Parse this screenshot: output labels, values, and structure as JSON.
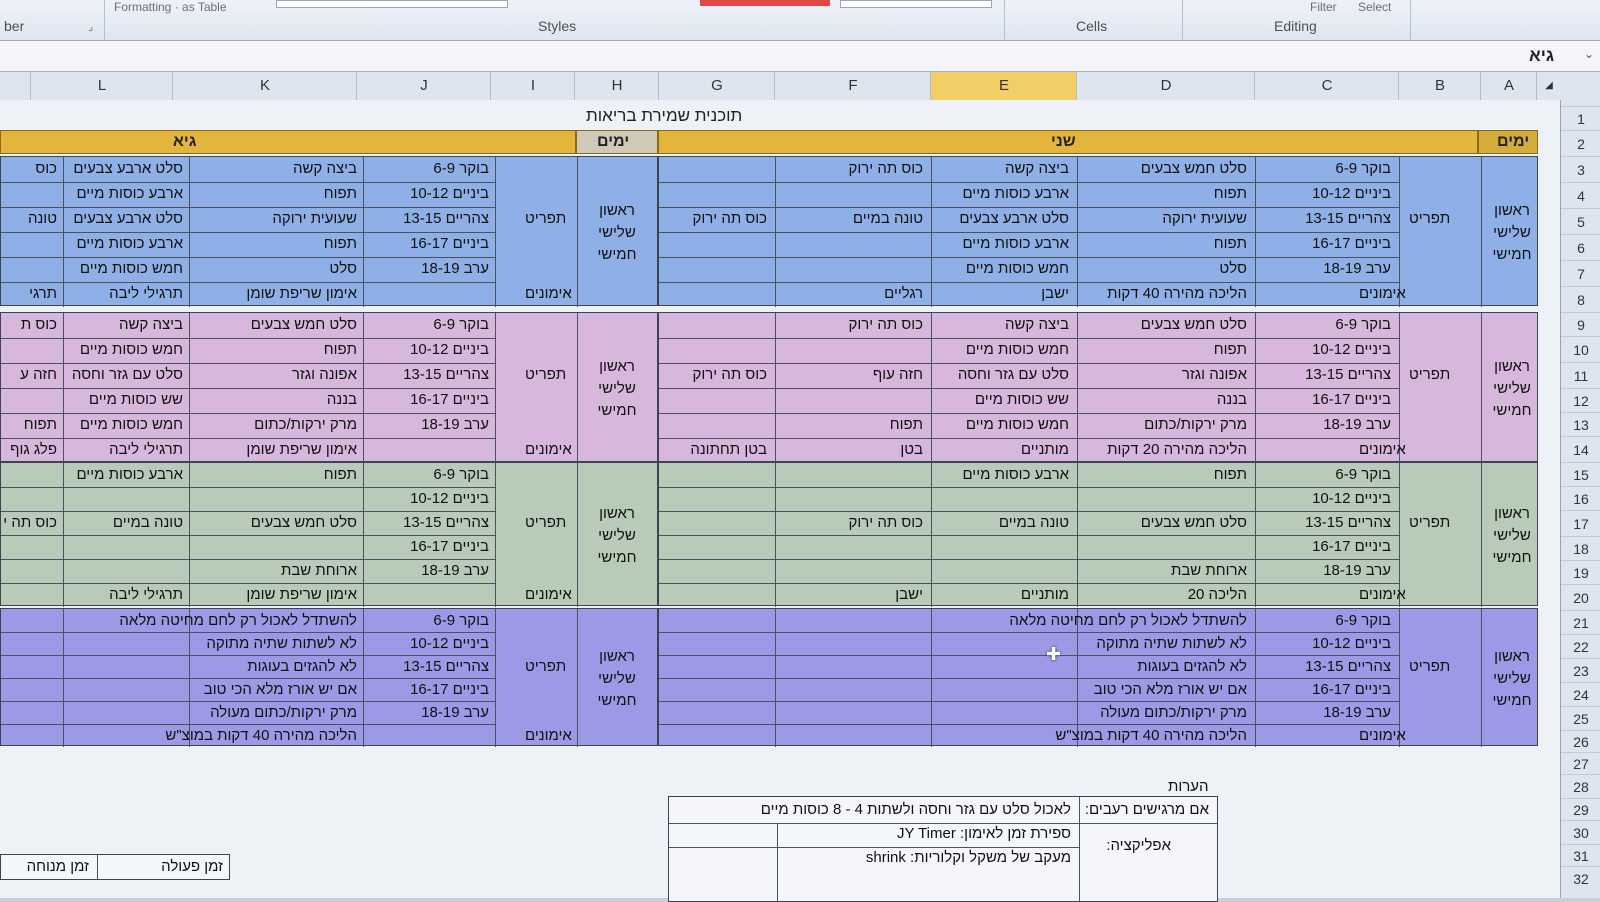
{
  "ribbon": {
    "groups": [
      "ber",
      "Styles",
      "Cells",
      "Editing"
    ],
    "faint": [
      "Formatting",
      "as Table",
      "Filter",
      "Select"
    ]
  },
  "formula_bar": {
    "value": "גיא"
  },
  "columns": [
    "L",
    "K",
    "J",
    "I",
    "H",
    "G",
    "F",
    "E",
    "D",
    "C",
    "B",
    "A"
  ],
  "selected_column": "E",
  "rows": [
    "1",
    "2",
    "3",
    "4",
    "5",
    "6",
    "7",
    "8",
    "9",
    "10",
    "11",
    "12",
    "13",
    "14",
    "15",
    "16",
    "17",
    "18",
    "19",
    "20",
    "21",
    "22",
    "23",
    "24",
    "25",
    "26",
    "27",
    "28",
    "29",
    "30",
    "31",
    "32"
  ],
  "sheet": {
    "title": "תוכנית שמירת בריאות",
    "right_header": {
      "yamim": "ימים",
      "name": "שני"
    },
    "left_header": {
      "yamim": "ימים",
      "name": "גיא"
    },
    "days_label": [
      "ראשון",
      "שלישי",
      "חמישי"
    ],
    "tafrit": "תפריט",
    "imunim": "אימונים",
    "times": [
      "בוקר 6-9",
      "ביניים 10-12",
      "צהריים 13-15",
      "ביניים 16-17",
      "ערב 18-19"
    ],
    "right_blocks": [
      {
        "d": [
          "סלט חמש צבעים",
          "תפוח",
          "שעועית ירוקה",
          "תפוח",
          "סלט"
        ],
        "e": [
          "ביצה קשה",
          "ארבע כוסות מיים",
          "סלט ארבע צבעים",
          "ארבע כוסות מיים",
          "חמש כוסות מיים"
        ],
        "f": [
          "כוס תה ירוק",
          "",
          "טונה במיים",
          "",
          ""
        ],
        "g": [
          "",
          "",
          "כוס תה ירוק",
          "",
          ""
        ],
        "training": {
          "d": "הליכה מהירה 40 דקות",
          "e": "ישבן",
          "f": "רגליים",
          "g": ""
        }
      },
      {
        "d": [
          "סלט חמש צבעים",
          "תפוח",
          "אפונה וגזר",
          "בננה",
          "מרק ירקות/כתום"
        ],
        "e": [
          "ביצה קשה",
          "חמש כוסות מיים",
          "סלט עם גזר וחסה",
          "שש כוסות מיים",
          "חמש כוסות מיים"
        ],
        "f": [
          "כוס תה ירוק",
          "",
          "חזה עוף",
          "",
          "תפוח"
        ],
        "g": [
          "",
          "",
          "כוס תה ירוק",
          "",
          ""
        ],
        "training": {
          "d": "הליכה מהירה 20 דקות",
          "e": "מותניים",
          "f": "בטן",
          "g": "בטן תחתונה"
        }
      },
      {
        "d": [
          "תפוח",
          "",
          "סלט חמש צבעים",
          "",
          "ארוחת שבת"
        ],
        "e": [
          "ארבע כוסות מיים",
          "",
          "טונה במיים",
          "",
          ""
        ],
        "f": [
          "",
          "",
          "כוס תה ירוק",
          "",
          ""
        ],
        "g": [
          "",
          "",
          "",
          "",
          ""
        ],
        "training": {
          "d": "הליכה 20",
          "e": "מותניים",
          "f": "ישבן",
          "g": ""
        }
      },
      {
        "wide": [
          "להשתדל לאכול רק לחם מחיטה מלאה",
          "לא לשתות שתיה מתוקה",
          "לא להגזים בעוגות",
          "אם יש אורז מלא הכי טוב",
          "מרק ירקות/כתום מעולה"
        ],
        "training": {
          "d": "הליכה מהירה 40 דקות במוצ\"ש"
        }
      }
    ],
    "left_blocks": [
      {
        "k": [
          "ביצה קשה",
          "תפוח",
          "שעועית ירוקה",
          "תפוח",
          "סלט"
        ],
        "l": [
          "סלט ארבע צבעים",
          "ארבע כוסות מיים",
          "סלט ארבע צבעים",
          "ארבע כוסות מיים",
          "חמש כוסות מיים"
        ],
        "edge": [
          "כוס",
          "",
          "טונה",
          "",
          ""
        ],
        "training": {
          "k": "אימון שריפת שומן",
          "l": "תרגילי ליבה",
          "edge": "תרגי"
        }
      },
      {
        "k": [
          "סלט חמש צבעים",
          "תפוח",
          "אפונה וגזר",
          "בננה",
          "מרק ירקות/כתום"
        ],
        "l": [
          "ביצה קשה",
          "חמש כוסות מיים",
          "סלט עם גזר וחסה",
          "שש כוסות מיים",
          "חמש כוסות מיים"
        ],
        "edge": [
          "כוס ת",
          "",
          "חזה ע",
          "",
          "תפוח"
        ],
        "training": {
          "k": "אימון שריפת שומן",
          "l": "תרגילי ליבה",
          "edge": "פלג גוף"
        }
      },
      {
        "k": [
          "תפוח",
          "",
          "סלט חמש צבעים",
          "",
          "ארוחת שבת"
        ],
        "l": [
          "ארבע כוסות מיים",
          "",
          "טונה במיים",
          "",
          ""
        ],
        "edge": [
          "",
          "",
          "כוס תה י",
          "",
          ""
        ],
        "training": {
          "k": "אימון שריפת שומן",
          "l": "תרגילי ליבה",
          "edge": ""
        }
      },
      {
        "wide": [
          "להשתדל לאכול רק לחם מחיטה מלאה",
          "לא לשתות שתיה מתוקה",
          "לא להגזים בעוגות",
          "אם יש אורז מלא הכי טוב",
          "מרק ירקות/כתום מעולה"
        ],
        "training": {
          "k": "הליכה מהירה 40 דקות במוצ\"ש"
        }
      }
    ],
    "notes": {
      "title": "הערות",
      "label1": "אם מרגישים רעבים:",
      "value1": "לאכול סלט עם גזר וחסה ולשתות 4 - 8 כוסות מיים",
      "label2": "אפליקציה:",
      "value2a": "ספירת זמן לאימון: JY Timer",
      "value2b": "מעקב של משקל וקלוריות: shrink"
    },
    "bottom_left": {
      "a": "זמן פעולה",
      "b": "זמן מנוחה"
    }
  },
  "colors": {
    "block1": "#8fb0e6",
    "block2": "#d7b8dc",
    "block3": "#b8cbb8",
    "block4": "#9c9ae6",
    "header_bar": "#e3b53c"
  }
}
